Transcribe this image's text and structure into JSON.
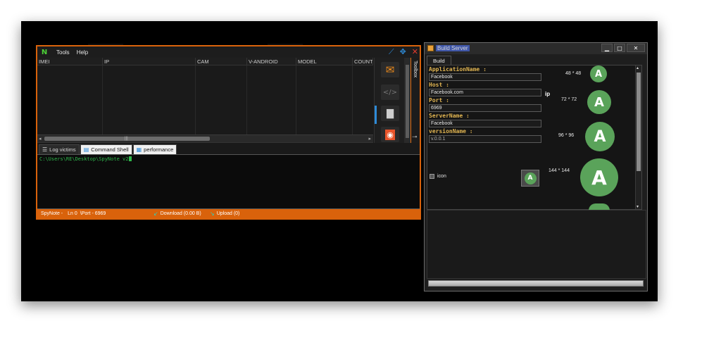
{
  "main_window": {
    "logo": "N",
    "menu": [
      "Tools",
      "Help"
    ],
    "grid_columns": [
      "IMEI",
      "IP",
      "CAM",
      "V-ANDROID",
      "MODEL",
      "COUNT"
    ],
    "toolbox_label": "Toolbox",
    "tabs": [
      {
        "label": "Log victims",
        "icon": "list-icon"
      },
      {
        "label": "Command Shell",
        "icon": "shell-icon"
      },
      {
        "label": "performance",
        "icon": "performance-icon"
      }
    ],
    "console_line": "C:\\Users\\RE\\Desktop\\SpyNote v2",
    "status": {
      "app": "SpyNote -",
      "ln": "Ln 0",
      "port": "\\Port - 6969",
      "download": "Download (0.00 B)",
      "upload": "Upload  (0)"
    },
    "colors": {
      "accent": "#d9620b",
      "console_text": "#2fb84c"
    }
  },
  "build_window": {
    "title": "Build Server",
    "tab": "Build",
    "fields": {
      "app_name_label": "ApplicationName :",
      "app_name_value": "Facebook",
      "host_label": "Host :",
      "host_value": "Facebook.com",
      "ip_label": "ip",
      "port_label": "Port :",
      "port_value": "6969",
      "server_name_label": "ServerName :",
      "server_name_value": "Facebook",
      "version_label": "versionName :",
      "version_value": "v.0.0.1"
    },
    "icon_sizes": [
      "48 * 48",
      "72 * 72",
      "96 * 96",
      "144 * 144"
    ],
    "icon_checkbox_label": "icon",
    "colors": {
      "label": "#e0b451",
      "android_green": "#5aa35a"
    }
  }
}
